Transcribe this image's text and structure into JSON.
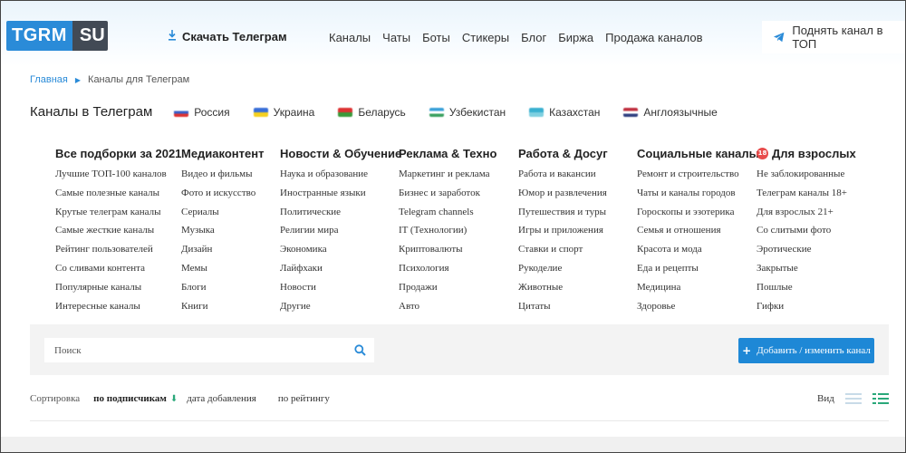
{
  "header": {
    "logo_left": "TGRM",
    "logo_right": "SU",
    "download_label": "Скачать Телеграм",
    "nav": [
      "Каналы",
      "Чаты",
      "Боты",
      "Стикеры",
      "Блог",
      "Биржа",
      "Продажа каналов"
    ],
    "promote_label": "Поднять канал в ТОП"
  },
  "breadcrumb": {
    "home": "Главная",
    "current": "Каналы для Телеграм"
  },
  "page": {
    "title": "Каналы в Телеграм",
    "countries": [
      {
        "label": "Россия",
        "colors": [
          "#ffffff",
          "#3a5fc8",
          "#d33"
        ]
      },
      {
        "label": "Украина",
        "colors": [
          "#3a6fd8",
          "#f5d020"
        ]
      },
      {
        "label": "Беларусь",
        "colors": [
          "#d33",
          "#3a9a3a"
        ]
      },
      {
        "label": "Узбекистан",
        "colors": [
          "#3aa0d8",
          "#ffffff",
          "#3aa060"
        ]
      },
      {
        "label": "Казахстан",
        "colors": [
          "#3ab0d0",
          "#7fd0e0"
        ]
      },
      {
        "label": "Англоязычные",
        "colors": [
          "#c03040",
          "#ffffff",
          "#304080"
        ]
      }
    ]
  },
  "categories": [
    {
      "title": "Все подборки за 2021",
      "items": [
        "Лучшие ТОП-100 каналов",
        "Самые полезные каналы",
        "Крутые телеграм каналы",
        "Самые жесткие каналы",
        "Рейтинг пользователей",
        "Со сливами контента",
        "Популярные каналы",
        "Интересные каналы"
      ]
    },
    {
      "title": "Медиаконтент",
      "items": [
        "Видео и фильмы",
        "Фото и искусство",
        "Сериалы",
        "Музыка",
        "Дизайн",
        "Мемы",
        "Блоги",
        "Книги"
      ]
    },
    {
      "title": "Новости & Обучение",
      "items": [
        "Наука и образование",
        "Иностранные языки",
        "Политические",
        "Религии мира",
        "Экономика",
        "Лайфхаки",
        "Новости",
        "Другие"
      ]
    },
    {
      "title": "Реклама & Техно",
      "items": [
        "Маркетинг и реклама",
        "Бизнес и заработок",
        "Telegram channels",
        "IT (Технологии)",
        "Криптовалюты",
        "Психология",
        "Продажи",
        "Авто"
      ]
    },
    {
      "title": "Работа & Досуг",
      "items": [
        "Работа и вакансии",
        "Юмор и развлечения",
        "Путешествия и туры",
        "Игры и приложения",
        "Ставки и спорт",
        "Рукоделие",
        "Животные",
        "Цитаты"
      ]
    },
    {
      "title": "Социальные каналы",
      "items": [
        "Ремонт и строительство",
        "Чаты и каналы городов",
        "Гороскопы и эзотерика",
        "Семья и отношения",
        "Красота и мода",
        "Еда и рецепты",
        "Медицина",
        "Здоровье"
      ]
    },
    {
      "title": "Для взрослых",
      "badge": "18",
      "items": [
        "Не заблокированные",
        "Телеграм каналы 18+",
        "Для взрослых 21+",
        "Со слитыми фото",
        "Эротические",
        "Закрытые",
        "Пошлые",
        "Гифки"
      ]
    }
  ],
  "search": {
    "placeholder": "Поиск",
    "value": ""
  },
  "add_button": {
    "label": "Добавить / изменить канал"
  },
  "sort": {
    "label": "Сортировка",
    "options": [
      "по подписчикам",
      "дата добавления",
      "по рейтингу"
    ],
    "active_index": 0
  },
  "view": {
    "label": "Вид",
    "modes": [
      "list-icon",
      "grid-icon"
    ],
    "active_mode": "grid-icon"
  },
  "colors": {
    "accent": "#2a8bd8",
    "logo_dark": "#424a55",
    "sort_arrow": "#2aa87a",
    "active_view": "#2aa87a",
    "inactive_view": "#c8dbe8"
  }
}
